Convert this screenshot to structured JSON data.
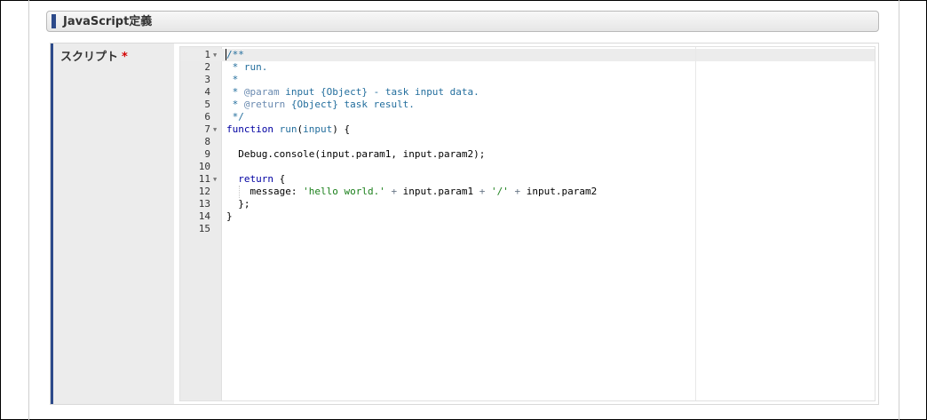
{
  "section": {
    "title": "JavaScript定義"
  },
  "form": {
    "label": "スクリプト",
    "required_mark": "*"
  },
  "editor": {
    "lines": [
      {
        "num": "1",
        "fold": true,
        "tokens": [
          {
            "t": "/**",
            "c": "c-comment"
          }
        ]
      },
      {
        "num": "2",
        "fold": false,
        "tokens": [
          {
            "t": " * run.",
            "c": "c-comment"
          }
        ]
      },
      {
        "num": "3",
        "fold": false,
        "tokens": [
          {
            "t": " *",
            "c": "c-comment"
          }
        ]
      },
      {
        "num": "4",
        "fold": false,
        "tokens": [
          {
            "t": " * ",
            "c": "c-comment"
          },
          {
            "t": "@param",
            "c": "c-doc"
          },
          {
            "t": " input {Object} - task input data.",
            "c": "c-comment"
          }
        ]
      },
      {
        "num": "5",
        "fold": false,
        "tokens": [
          {
            "t": " * ",
            "c": "c-comment"
          },
          {
            "t": "@return",
            "c": "c-doc"
          },
          {
            "t": " {Object} task result.",
            "c": "c-comment"
          }
        ]
      },
      {
        "num": "6",
        "fold": false,
        "tokens": [
          {
            "t": " */",
            "c": "c-comment"
          }
        ]
      },
      {
        "num": "7",
        "fold": true,
        "tokens": [
          {
            "t": "function",
            "c": "c-kw"
          },
          {
            "t": " ",
            "c": ""
          },
          {
            "t": "run",
            "c": "c-comment"
          },
          {
            "t": "(",
            "c": ""
          },
          {
            "t": "input",
            "c": "c-comment"
          },
          {
            "t": ") {",
            "c": ""
          }
        ]
      },
      {
        "num": "8",
        "fold": false,
        "tokens": []
      },
      {
        "num": "9",
        "fold": false,
        "tokens": [
          {
            "t": "  Debug.console(input.param1, input.param2);",
            "c": ""
          }
        ]
      },
      {
        "num": "10",
        "fold": false,
        "tokens": []
      },
      {
        "num": "11",
        "fold": true,
        "tokens": [
          {
            "t": "  ",
            "c": ""
          },
          {
            "t": "return",
            "c": "c-kw"
          },
          {
            "t": " {",
            "c": ""
          }
        ]
      },
      {
        "num": "12",
        "fold": false,
        "guide": true,
        "tokens": [
          {
            "t": "    message: ",
            "c": ""
          },
          {
            "t": "'hello world.'",
            "c": "c-str"
          },
          {
            "t": " ",
            "c": ""
          },
          {
            "t": "+",
            "c": "c-op"
          },
          {
            "t": " input.param1 ",
            "c": ""
          },
          {
            "t": "+",
            "c": "c-op"
          },
          {
            "t": " ",
            "c": ""
          },
          {
            "t": "'/'",
            "c": "c-str"
          },
          {
            "t": " ",
            "c": ""
          },
          {
            "t": "+",
            "c": "c-op"
          },
          {
            "t": " input.param2",
            "c": ""
          }
        ]
      },
      {
        "num": "13",
        "fold": false,
        "tokens": [
          {
            "t": "  };",
            "c": ""
          }
        ]
      },
      {
        "num": "14",
        "fold": false,
        "tokens": [
          {
            "t": "}",
            "c": ""
          }
        ]
      },
      {
        "num": "15",
        "fold": false,
        "tokens": []
      }
    ],
    "fold_glyph": "▼"
  }
}
